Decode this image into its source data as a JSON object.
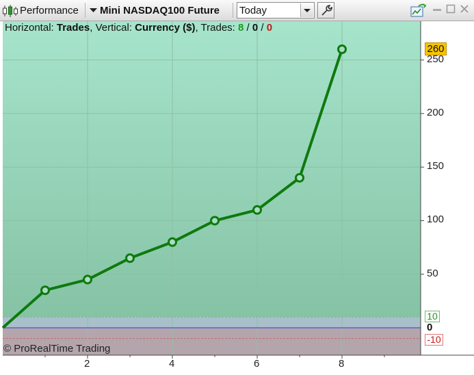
{
  "toolbar": {
    "indicator_label": "Performance",
    "instrument": "Mini NASDAQ100 Future",
    "period_value": "Today"
  },
  "header": {
    "horizontal_label": "Horizontal:",
    "horizontal_value": "Trades",
    "vertical_label": ", Vertical:",
    "vertical_value": "Currency ($)",
    "trades_label": ", Trades:",
    "trades_winning": "8",
    "trades_sep1": "/",
    "trades_neutral": "0",
    "trades_sep2": "/",
    "trades_losing": "0"
  },
  "credit": "© ProRealTime Trading",
  "colors": {
    "line": "#0e7a0e",
    "win": "#1a9a1a",
    "loss": "#c41a1a",
    "zero_line": "#2a3fd0",
    "badge": "#f5c400"
  },
  "chart_data": {
    "type": "line",
    "x": [
      0,
      1,
      2,
      3,
      4,
      5,
      6,
      7,
      8
    ],
    "y": [
      0,
      35,
      45,
      65,
      80,
      100,
      110,
      140,
      260
    ],
    "xlim": [
      0,
      10
    ],
    "ylim": [
      -27,
      287
    ],
    "x_ticks": [
      "2",
      "4",
      "6",
      "8"
    ],
    "y_ticks": [
      "250",
      "200",
      "150",
      "100",
      "50"
    ],
    "zero_label": "0",
    "upper_band": 10,
    "lower_band": -10,
    "upper_band_label": "10",
    "lower_band_label": "-10",
    "last_value_label": "260",
    "grid": true
  }
}
